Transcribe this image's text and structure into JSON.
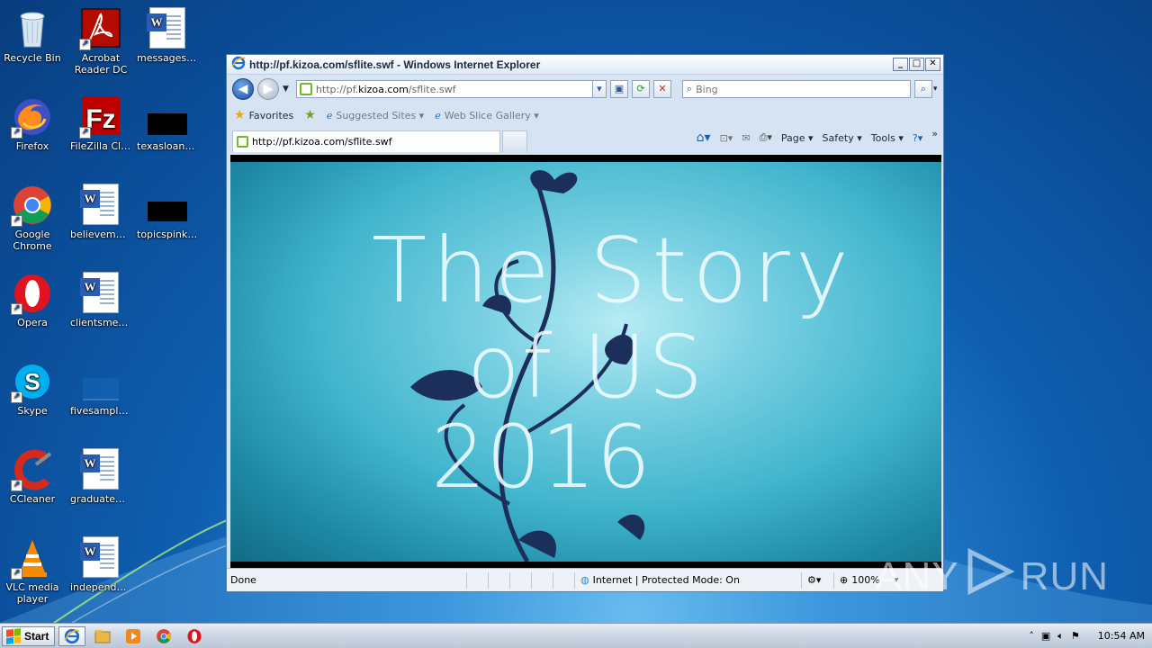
{
  "desktop": {
    "icons": [
      {
        "label": "Recycle Bin"
      },
      {
        "label": "Acrobat Reader DC"
      },
      {
        "label": "messagesfo..."
      },
      {
        "label": "Firefox"
      },
      {
        "label": "FileZilla Client"
      },
      {
        "label": "texasloans.jpg"
      },
      {
        "label": "Google Chrome"
      },
      {
        "label": "believemd.rtf"
      },
      {
        "label": "topicspink.jpg"
      },
      {
        "label": "Opera"
      },
      {
        "label": "clientsmexic..."
      },
      {
        "label": "Skype"
      },
      {
        "label": "fivesample...."
      },
      {
        "label": "CCleaner"
      },
      {
        "label": "graduatepic..."
      },
      {
        "label": "VLC media player"
      },
      {
        "label": "independen..."
      }
    ]
  },
  "ie": {
    "title": "http://pf.kizoa.com/sflite.swf - Windows Internet Explorer",
    "address_prefix": "http://pf.",
    "address_domain": "kizoa.com",
    "address_suffix": "/sflite.swf",
    "search_placeholder": "Bing",
    "favorites_label": "Favorites",
    "suggested_sites": "Suggested Sites ▾",
    "web_slice_gallery": "Web Slice Gallery ▾",
    "tab_title": "http://pf.kizoa.com/sflite.swf",
    "menu_page": "Page ▾",
    "menu_safety": "Safety ▾",
    "menu_tools": "Tools ▾",
    "status_text": "Done",
    "zone_text": "Internet | Protected Mode: On",
    "zoom_text": "100%"
  },
  "flash": {
    "line1": "The Story",
    "line2": "of US",
    "line3": "2016"
  },
  "taskbar": {
    "start_label": "Start",
    "clock": "10:54 AM"
  },
  "watermark": {
    "text_left": "ANY",
    "text_right": "RUN"
  },
  "colors": {
    "desktop_accent": "#0f5fb0",
    "flash_teal": "#41b5cd",
    "ie_frame": "#d6e3f2"
  }
}
